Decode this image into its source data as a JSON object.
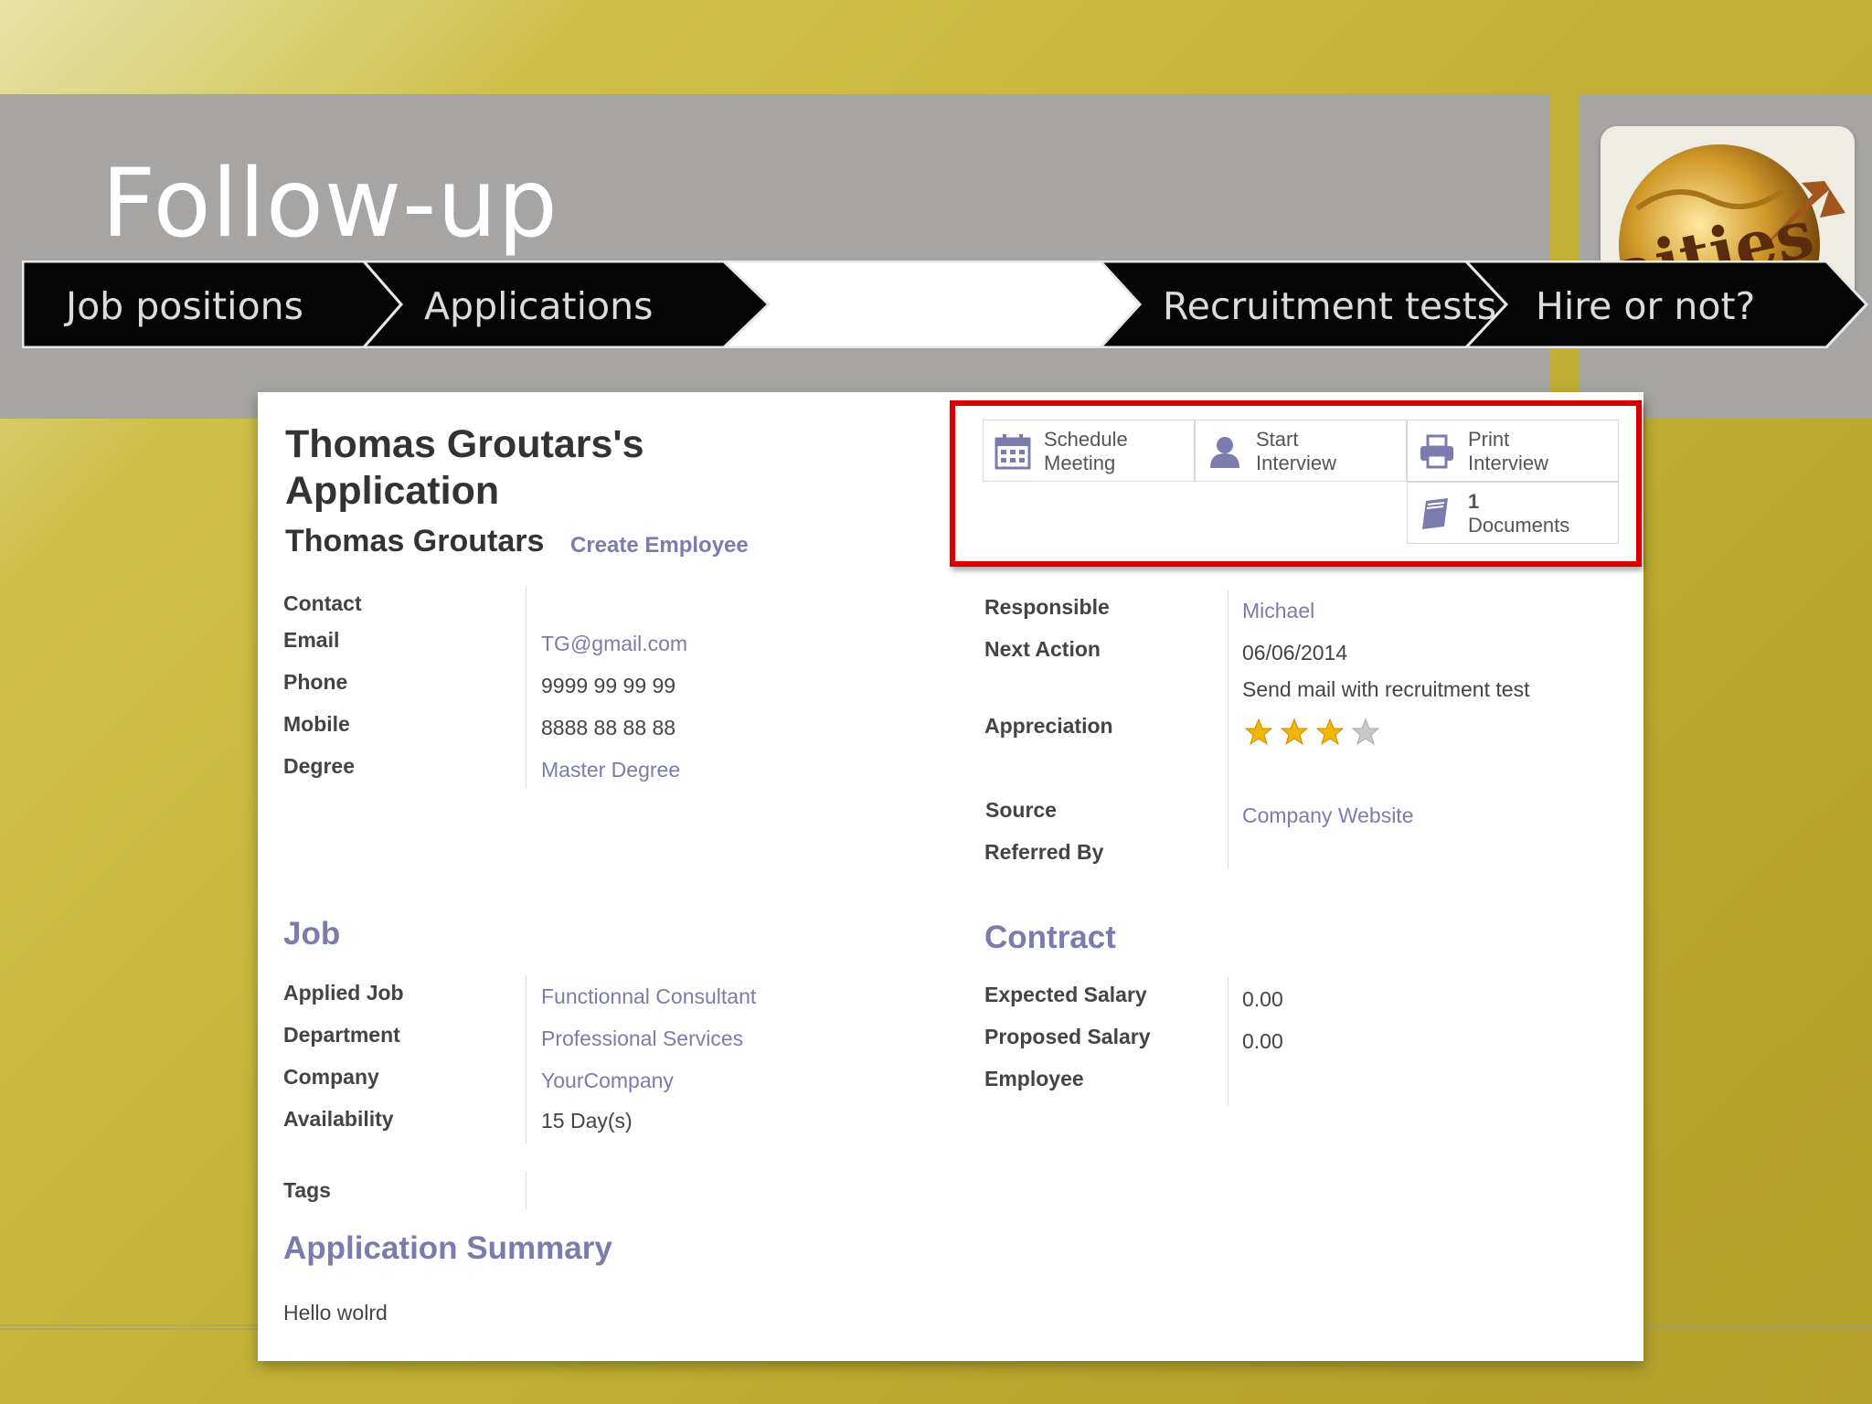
{
  "slide": {
    "title": "Follow-up"
  },
  "process_steps": [
    {
      "label": "Job positions"
    },
    {
      "label": "Applications"
    },
    {
      "label": ""
    },
    {
      "label": "Recruitment tests"
    },
    {
      "label": "Hire or not?"
    }
  ],
  "logo": {
    "text": "aities"
  },
  "form": {
    "title": "Thomas Groutars's Application",
    "applicant_name": "Thomas Groutars",
    "create_employee": "Create Employee",
    "smart_buttons": {
      "schedule": {
        "line1": "Schedule",
        "line2": "Meeting",
        "icon": "calendar-icon"
      },
      "interview": {
        "line1": "Start",
        "line2": "Interview",
        "icon": "user-icon"
      },
      "print": {
        "line1": "Print",
        "line2": "Interview",
        "icon": "printer-icon"
      },
      "documents": {
        "line1": "1",
        "line2": "Documents",
        "icon": "book-icon"
      }
    },
    "contact": {
      "label": "Contact",
      "email_label": "Email",
      "email": "TG@gmail.com",
      "phone_label": "Phone",
      "phone": "9999 99 99 99",
      "mobile_label": "Mobile",
      "mobile": "8888 88 88 88",
      "degree_label": "Degree",
      "degree": "Master Degree"
    },
    "right": {
      "responsible_label": "Responsible",
      "responsible": "Michael",
      "next_action_label": "Next Action",
      "next_action_date": "06/06/2014",
      "next_action_text": "Send mail with recruitment test",
      "appreciation_label": "Appreciation",
      "appreciation_stars": 3,
      "appreciation_max": 4,
      "source_label": "Source",
      "source": "Company Website",
      "referred_label": "Referred By"
    },
    "job": {
      "heading": "Job",
      "applied_job_label": "Applied Job",
      "applied_job": "Functionnal Consultant",
      "department_label": "Department",
      "department": "Professional Services",
      "company_label": "Company",
      "company": "YourCompany",
      "availability_label": "Availability",
      "availability_value": "15",
      "availability_unit": "Day(s)",
      "tags_label": "Tags"
    },
    "contract": {
      "heading": "Contract",
      "expected_label": "Expected Salary",
      "expected": "0.00",
      "proposed_label": "Proposed Salary",
      "proposed": "0.00",
      "employee_label": "Employee"
    },
    "summary": {
      "heading": "Application Summary",
      "text": "Hello wolrd"
    }
  }
}
